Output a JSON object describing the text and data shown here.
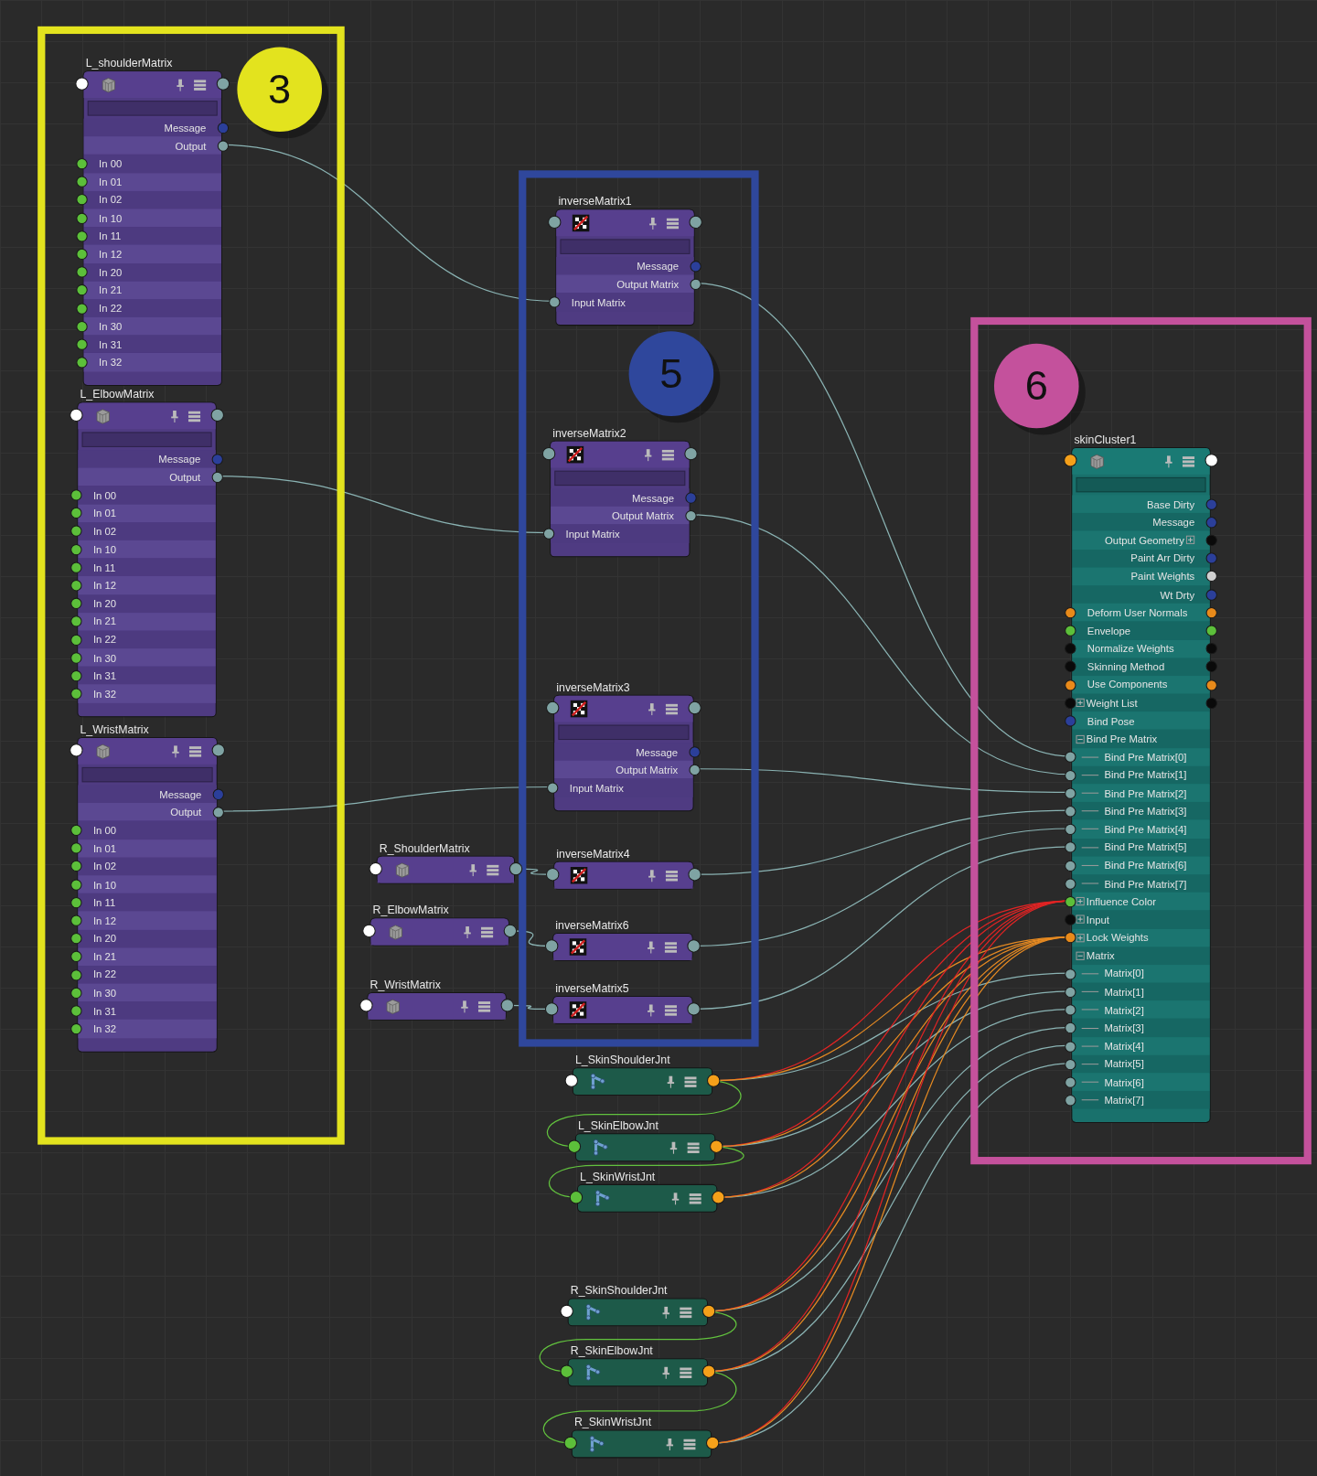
{
  "frames": [
    {
      "label": "3",
      "color": "#e3e31e"
    },
    {
      "label": "5",
      "color": "#2f479c"
    },
    {
      "label": "6",
      "color": "#c4519c"
    }
  ],
  "nodes": [
    {
      "name": "L_shoulderMatrix",
      "kind": "matrix",
      "in_port": {
        "color": "#ffffff"
      },
      "out_port": {
        "color": "#7fa3a3"
      },
      "attributes": [
        {
          "label": "Message",
          "out_port": {
            "color": "#2b3f9a"
          }
        },
        {
          "label": "Output",
          "out_port": {
            "color": "#7fa3a3"
          }
        },
        {
          "label": "In 00",
          "in_port": {
            "color": "#5cbf3a"
          }
        },
        {
          "label": "In 01",
          "in_port": {
            "color": "#5cbf3a"
          }
        },
        {
          "label": "In 02",
          "in_port": {
            "color": "#5cbf3a"
          }
        },
        {
          "label": "In 10",
          "in_port": {
            "color": "#5cbf3a"
          }
        },
        {
          "label": "In 11",
          "in_port": {
            "color": "#5cbf3a"
          }
        },
        {
          "label": "In 12",
          "in_port": {
            "color": "#5cbf3a"
          }
        },
        {
          "label": "In 20",
          "in_port": {
            "color": "#5cbf3a"
          }
        },
        {
          "label": "In 21",
          "in_port": {
            "color": "#5cbf3a"
          }
        },
        {
          "label": "In 22",
          "in_port": {
            "color": "#5cbf3a"
          }
        },
        {
          "label": "In 30",
          "in_port": {
            "color": "#5cbf3a"
          }
        },
        {
          "label": "In 31",
          "in_port": {
            "color": "#5cbf3a"
          }
        },
        {
          "label": "In 32",
          "in_port": {
            "color": "#5cbf3a"
          }
        }
      ]
    },
    {
      "name": "L_ElbowMatrix",
      "kind": "matrix",
      "in_port": {
        "color": "#ffffff"
      },
      "out_port": {
        "color": "#7fa3a3"
      },
      "attributes": [
        {
          "label": "Message",
          "out_port": {
            "color": "#2b3f9a"
          }
        },
        {
          "label": "Output",
          "out_port": {
            "color": "#7fa3a3"
          }
        },
        {
          "label": "In 00",
          "in_port": {
            "color": "#5cbf3a"
          }
        },
        {
          "label": "In 01",
          "in_port": {
            "color": "#5cbf3a"
          }
        },
        {
          "label": "In 02",
          "in_port": {
            "color": "#5cbf3a"
          }
        },
        {
          "label": "In 10",
          "in_port": {
            "color": "#5cbf3a"
          }
        },
        {
          "label": "In 11",
          "in_port": {
            "color": "#5cbf3a"
          }
        },
        {
          "label": "In 12",
          "in_port": {
            "color": "#5cbf3a"
          }
        },
        {
          "label": "In 20",
          "in_port": {
            "color": "#5cbf3a"
          }
        },
        {
          "label": "In 21",
          "in_port": {
            "color": "#5cbf3a"
          }
        },
        {
          "label": "In 22",
          "in_port": {
            "color": "#5cbf3a"
          }
        },
        {
          "label": "In 30",
          "in_port": {
            "color": "#5cbf3a"
          }
        },
        {
          "label": "In 31",
          "in_port": {
            "color": "#5cbf3a"
          }
        },
        {
          "label": "In 32",
          "in_port": {
            "color": "#5cbf3a"
          }
        }
      ]
    },
    {
      "name": "L_WristMatrix",
      "kind": "matrix",
      "in_port": {
        "color": "#ffffff"
      },
      "out_port": {
        "color": "#7fa3a3"
      },
      "attributes": [
        {
          "label": "Message",
          "out_port": {
            "color": "#2b3f9a"
          }
        },
        {
          "label": "Output",
          "out_port": {
            "color": "#7fa3a3"
          }
        },
        {
          "label": "In 00",
          "in_port": {
            "color": "#5cbf3a"
          }
        },
        {
          "label": "In 01",
          "in_port": {
            "color": "#5cbf3a"
          }
        },
        {
          "label": "In 02",
          "in_port": {
            "color": "#5cbf3a"
          }
        },
        {
          "label": "In 10",
          "in_port": {
            "color": "#5cbf3a"
          }
        },
        {
          "label": "In 11",
          "in_port": {
            "color": "#5cbf3a"
          }
        },
        {
          "label": "In 12",
          "in_port": {
            "color": "#5cbf3a"
          }
        },
        {
          "label": "In 20",
          "in_port": {
            "color": "#5cbf3a"
          }
        },
        {
          "label": "In 21",
          "in_port": {
            "color": "#5cbf3a"
          }
        },
        {
          "label": "In 22",
          "in_port": {
            "color": "#5cbf3a"
          }
        },
        {
          "label": "In 30",
          "in_port": {
            "color": "#5cbf3a"
          }
        },
        {
          "label": "In 31",
          "in_port": {
            "color": "#5cbf3a"
          }
        },
        {
          "label": "In 32",
          "in_port": {
            "color": "#5cbf3a"
          }
        }
      ]
    },
    {
      "name": "inverseMatrix1",
      "kind": "inverse",
      "in_port": {
        "color": "#7fa3a3"
      },
      "out_port": {
        "color": "#7fa3a3"
      },
      "attributes": [
        {
          "label": "Message",
          "out_port": {
            "color": "#2b3f9a"
          }
        },
        {
          "label": "Output Matrix",
          "out_port": {
            "color": "#7fa3a3"
          }
        },
        {
          "label": "Input Matrix",
          "in_port": {
            "color": "#7fa3a3"
          }
        }
      ]
    },
    {
      "name": "inverseMatrix2",
      "kind": "inverse",
      "in_port": {
        "color": "#7fa3a3"
      },
      "out_port": {
        "color": "#7fa3a3"
      },
      "attributes": [
        {
          "label": "Message",
          "out_port": {
            "color": "#2b3f9a"
          }
        },
        {
          "label": "Output Matrix",
          "out_port": {
            "color": "#7fa3a3"
          }
        },
        {
          "label": "Input Matrix",
          "in_port": {
            "color": "#7fa3a3"
          }
        }
      ]
    },
    {
      "name": "inverseMatrix3",
      "kind": "inverse",
      "in_port": {
        "color": "#7fa3a3"
      },
      "out_port": {
        "color": "#7fa3a3"
      },
      "attributes": [
        {
          "label": "Message",
          "out_port": {
            "color": "#2b3f9a"
          }
        },
        {
          "label": "Output Matrix",
          "out_port": {
            "color": "#7fa3a3"
          }
        },
        {
          "label": "Input Matrix",
          "in_port": {
            "color": "#7fa3a3"
          }
        }
      ]
    },
    {
      "name": "inverseMatrix4",
      "kind": "inverse",
      "in_port": {
        "color": "#7fa3a3"
      },
      "out_port": {
        "color": "#7fa3a3"
      }
    },
    {
      "name": "inverseMatrix6",
      "kind": "inverse",
      "in_port": {
        "color": "#7fa3a3"
      },
      "out_port": {
        "color": "#7fa3a3"
      }
    },
    {
      "name": "inverseMatrix5",
      "kind": "inverse",
      "in_port": {
        "color": "#7fa3a3"
      },
      "out_port": {
        "color": "#7fa3a3"
      }
    },
    {
      "name": "R_ShoulderMatrix",
      "kind": "matrix",
      "in_port": {
        "color": "#ffffff"
      },
      "out_port": {
        "color": "#7fa3a3"
      }
    },
    {
      "name": "R_ElbowMatrix",
      "kind": "matrix",
      "in_port": {
        "color": "#ffffff"
      },
      "out_port": {
        "color": "#7fa3a3"
      }
    },
    {
      "name": "R_WristMatrix",
      "kind": "matrix",
      "in_port": {
        "color": "#ffffff"
      },
      "out_port": {
        "color": "#7fa3a3"
      }
    },
    {
      "name": "skinCluster1",
      "kind": "skin",
      "in_port": {
        "color": "#f5a01a"
      },
      "out_port": {
        "color": "#ffffff"
      },
      "attributes": [
        {
          "label": "Base Dirty",
          "out_port": {
            "color": "#2b3f9a"
          }
        },
        {
          "label": "Message",
          "out_port": {
            "color": "#2b3f9a"
          }
        },
        {
          "label": "Output Geometry",
          "expanded": false,
          "out_port": {
            "color": "#0a0a0a"
          }
        },
        {
          "label": "Paint Arr Dirty",
          "out_port": {
            "color": "#2b3f9a"
          }
        },
        {
          "label": "Paint Weights",
          "out_port": {
            "color": "#d0d0d0"
          }
        },
        {
          "label": "Wt Drty",
          "out_port": {
            "color": "#2b3f9a"
          }
        },
        {
          "label": "Deform User Normals",
          "in_port": {
            "color": "#e88a1a"
          },
          "out_port": {
            "color": "#e88a1a"
          }
        },
        {
          "label": "Envelope",
          "in_port": {
            "color": "#5cbf3a"
          },
          "out_port": {
            "color": "#5cbf3a"
          }
        },
        {
          "label": "Normalize Weights",
          "in_port": {
            "color": "#0a0a0a"
          },
          "out_port": {
            "color": "#0a0a0a"
          }
        },
        {
          "label": "Skinning Method",
          "in_port": {
            "color": "#0a0a0a"
          },
          "out_port": {
            "color": "#0a0a0a"
          }
        },
        {
          "label": "Use Components",
          "in_port": {
            "color": "#e88a1a"
          },
          "out_port": {
            "color": "#e88a1a"
          }
        },
        {
          "label": "Weight List",
          "expanded": false,
          "in_port": {
            "color": "#0a0a0a"
          },
          "out_port": {
            "color": "#0a0a0a"
          }
        },
        {
          "label": "Bind Pose",
          "in_port": {
            "color": "#2b3f9a"
          }
        },
        {
          "label": "Bind Pre Matrix",
          "expanded": true,
          "children": [
            {
              "label": "Bind Pre Matrix[0]",
              "in_port": {
                "color": "#7fa3a3"
              }
            },
            {
              "label": "Bind Pre Matrix[1]",
              "in_port": {
                "color": "#7fa3a3"
              }
            },
            {
              "label": "Bind Pre Matrix[2]",
              "in_port": {
                "color": "#7fa3a3"
              }
            },
            {
              "label": "Bind Pre Matrix[3]",
              "in_port": {
                "color": "#7fa3a3"
              }
            },
            {
              "label": "Bind Pre Matrix[4]",
              "in_port": {
                "color": "#7fa3a3"
              }
            },
            {
              "label": "Bind Pre Matrix[5]",
              "in_port": {
                "color": "#7fa3a3"
              }
            },
            {
              "label": "Bind Pre Matrix[6]",
              "in_port": {
                "color": "#7fa3a3"
              }
            },
            {
              "label": "Bind Pre Matrix[7]",
              "in_port": {
                "color": "#7fa3a3"
              }
            }
          ]
        },
        {
          "label": "Influence Color",
          "expanded": false,
          "in_port": {
            "color": "#5cbf3a"
          }
        },
        {
          "label": "Input",
          "expanded": false,
          "in_port": {
            "color": "#0a0a0a"
          }
        },
        {
          "label": "Lock Weights",
          "expanded": false,
          "in_port": {
            "color": "#e88a1a"
          }
        },
        {
          "label": "Matrix",
          "expanded": true,
          "children": [
            {
              "label": "Matrix[0]",
              "in_port": {
                "color": "#7fa3a3"
              }
            },
            {
              "label": "Matrix[1]",
              "in_port": {
                "color": "#7fa3a3"
              }
            },
            {
              "label": "Matrix[2]",
              "in_port": {
                "color": "#7fa3a3"
              }
            },
            {
              "label": "Matrix[3]",
              "in_port": {
                "color": "#7fa3a3"
              }
            },
            {
              "label": "Matrix[4]",
              "in_port": {
                "color": "#7fa3a3"
              }
            },
            {
              "label": "Matrix[5]",
              "in_port": {
                "color": "#7fa3a3"
              }
            },
            {
              "label": "Matrix[6]",
              "in_port": {
                "color": "#7fa3a3"
              }
            },
            {
              "label": "Matrix[7]",
              "in_port": {
                "color": "#7fa3a3"
              }
            }
          ]
        }
      ]
    },
    {
      "name": "L_SkinShoulderJnt",
      "kind": "joint",
      "in_port": {
        "color": "#ffffff"
      },
      "out_port": {
        "color": "#f5a01a"
      }
    },
    {
      "name": "L_SkinElbowJnt",
      "kind": "joint",
      "in_port": {
        "color": "#5cbf3a"
      },
      "out_port": {
        "color": "#f5a01a"
      }
    },
    {
      "name": "L_SkinWristJnt",
      "kind": "joint",
      "in_port": {
        "color": "#5cbf3a"
      },
      "out_port": {
        "color": "#f5a01a"
      }
    },
    {
      "name": "R_SkinShoulderJnt",
      "kind": "joint",
      "in_port": {
        "color": "#ffffff"
      },
      "out_port": {
        "color": "#f5a01a"
      }
    },
    {
      "name": "R_SkinElbowJnt",
      "kind": "joint",
      "in_port": {
        "color": "#5cbf3a"
      },
      "out_port": {
        "color": "#f5a01a"
      }
    },
    {
      "name": "R_SkinWristJnt",
      "kind": "joint",
      "in_port": {
        "color": "#5cbf3a"
      },
      "out_port": {
        "color": "#f5a01a"
      }
    }
  ]
}
